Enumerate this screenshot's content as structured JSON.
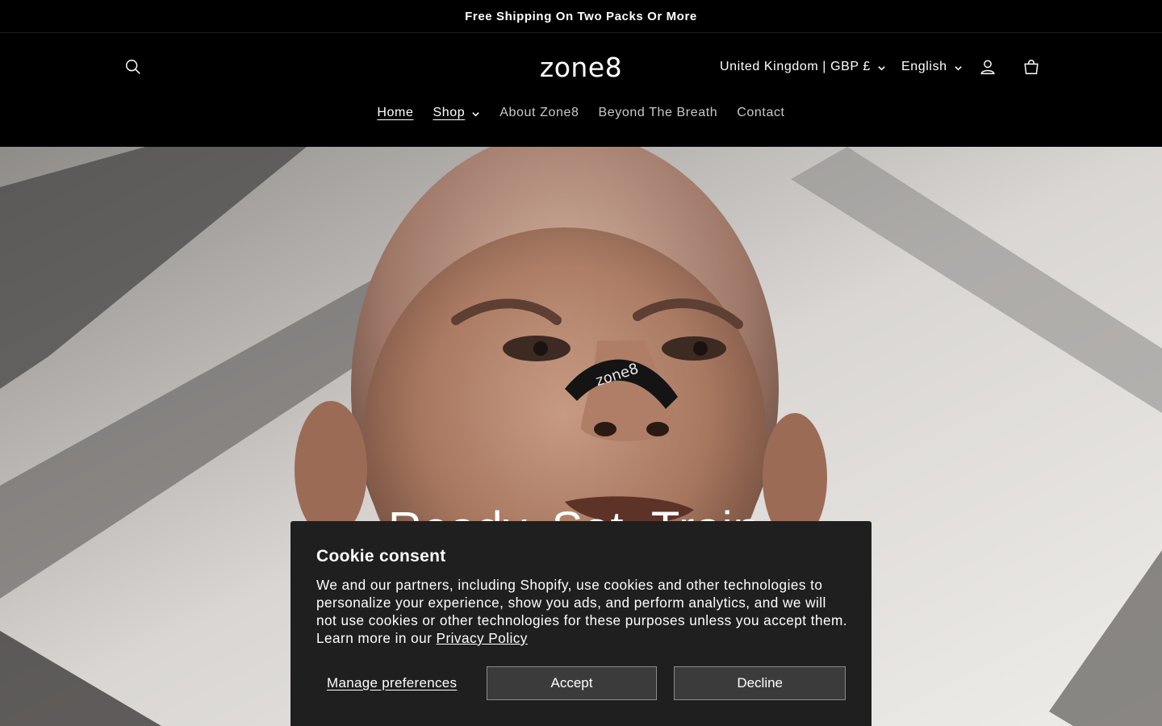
{
  "announcement": {
    "text": "Free Shipping On Two Packs Or More"
  },
  "header": {
    "logo": "zone8",
    "country": "United Kingdom | GBP £",
    "language": "English",
    "icons": {
      "search": "search-icon",
      "account": "account-icon",
      "cart": "cart-icon"
    }
  },
  "nav": {
    "items": [
      {
        "label": "Home"
      },
      {
        "label": "Shop"
      },
      {
        "label": "About Zone8"
      },
      {
        "label": "Beyond The Breath"
      },
      {
        "label": "Contact"
      }
    ]
  },
  "hero": {
    "heading": "Ready. Set. Train."
  },
  "cookie": {
    "title": "Cookie consent",
    "text": "We and our partners, including Shopify, use cookies and other technologies to personalize your experience, show you ads, and perform analytics, and we will not use cookies or other technologies for these purposes unless you accept them. Learn more in our",
    "privacy_link": "Privacy Policy",
    "manage": "Manage preferences",
    "accept": "Accept",
    "decline": "Decline"
  },
  "colors": {
    "background": "#000000",
    "banner": "#1f1f1f",
    "button": "#3b3b3b"
  }
}
